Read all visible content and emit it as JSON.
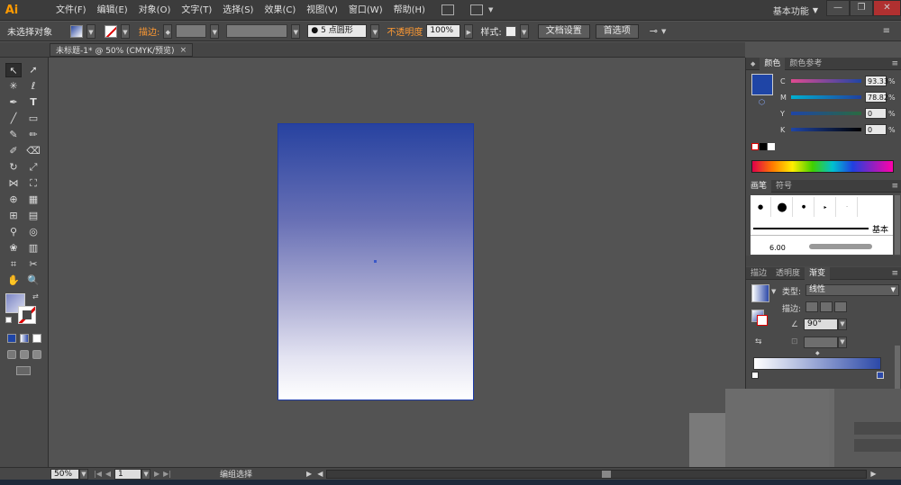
{
  "app": {
    "logo": "Ai",
    "workspace": "基本功能"
  },
  "menu": [
    "文件(F)",
    "编辑(E)",
    "对象(O)",
    "文字(T)",
    "选择(S)",
    "效果(C)",
    "视图(V)",
    "窗口(W)",
    "帮助(H)"
  ],
  "controlbar": {
    "selection": "未选择对象",
    "stroke_label": "描边:",
    "brush_size": "5 点圆形",
    "opacity_label": "不透明度",
    "opacity_value": "100%",
    "style_label": "样式:",
    "doc_setup": "文档设置",
    "preferences": "首选项"
  },
  "document": {
    "tab_title": "未标题-1* @ 50% (CMYK/预览)",
    "close": "×"
  },
  "statusbar": {
    "zoom": "50%",
    "page": "1",
    "status": "编组选择"
  },
  "panels": {
    "color": {
      "tabs": [
        "颜色",
        "颜色参考"
      ],
      "swatch_color": "#1f45a6",
      "channels": [
        {
          "label": "C",
          "value": "93.33",
          "pct": "%"
        },
        {
          "label": "M",
          "value": "78.82",
          "pct": "%"
        },
        {
          "label": "Y",
          "value": "0",
          "pct": "%"
        },
        {
          "label": "K",
          "value": "0",
          "pct": "%"
        }
      ]
    },
    "brushes": {
      "tabs": [
        "画笔",
        "符号"
      ],
      "basic_label": "基本",
      "size_label": "6.00"
    },
    "gradient": {
      "tabs": [
        "描边",
        "透明度",
        "渐变"
      ],
      "type_label": "类型:",
      "type_value": "线性",
      "stroke_label": "描边:",
      "angle": "90°",
      "start_color": "#ffffff",
      "end_color": "#2c49a8"
    }
  },
  "colors": {
    "accent": "#ff9a00",
    "artboard_top": "#2742a0",
    "artboard_bottom": "#ffffff"
  }
}
